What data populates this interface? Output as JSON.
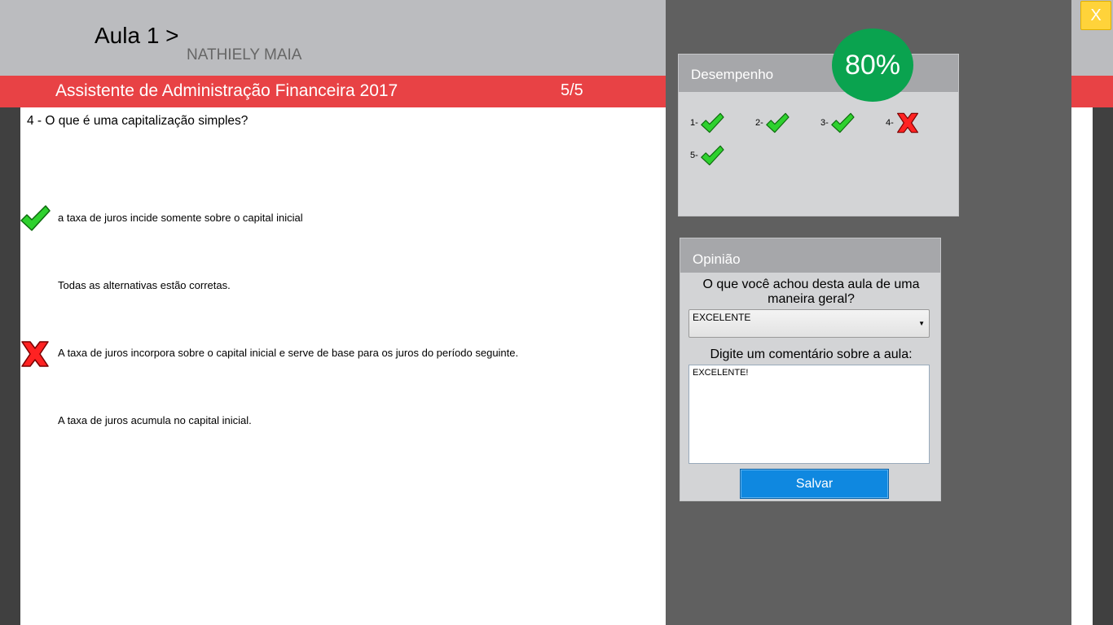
{
  "header": {
    "lesson_title": "Aula 1 >",
    "user_name": "NATHIELY MAIA"
  },
  "course_bar": {
    "title": "Assistente de Administração Financeira 2017",
    "progress": "5/5"
  },
  "question": {
    "text": "4 - O que é uma capitalização simples?",
    "options": [
      {
        "text": "a taxa de juros incide somente sobre o capital inicial",
        "mark": "correct"
      },
      {
        "text": "Todas as alternativas estão corretas.",
        "mark": "none"
      },
      {
        "text": "A taxa de juros incorpora sobre o capital inicial e serve de base para os juros do período seguinte.",
        "mark": "wrong"
      },
      {
        "text": "A taxa de juros acumula no capital inicial.",
        "mark": "none"
      }
    ]
  },
  "performance": {
    "title": "Desempenho",
    "score": "80%",
    "items": [
      {
        "label": "1-",
        "result": "correct"
      },
      {
        "label": "2-",
        "result": "correct"
      },
      {
        "label": "3-",
        "result": "correct"
      },
      {
        "label": "4-",
        "result": "wrong"
      },
      {
        "label": "5-",
        "result": "correct"
      }
    ]
  },
  "opinion": {
    "title": "Opinião",
    "question": "O que você achou desta aula de uma maneira geral?",
    "rating_value": "EXCELENTE",
    "comment_label": "Digite um comentário sobre a aula:",
    "comment_value": "EXCELENTE!",
    "save_label": "Salvar"
  },
  "close_label": "X",
  "colors": {
    "header_gray": "#bbbcbf",
    "course_red": "#e84245",
    "score_green": "#0aa34f",
    "save_blue": "#0f88e0",
    "close_yellow": "#ffd33a",
    "overlay_gray": "#606060"
  },
  "icons": {
    "correct": "check-icon",
    "wrong": "cross-icon",
    "dropdown": "chevron-down-icon"
  }
}
